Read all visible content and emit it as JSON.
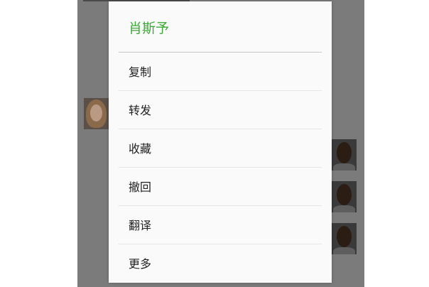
{
  "dialog": {
    "title": "肖斯予",
    "title_color": "#3aaa35",
    "items": [
      {
        "label": "复制"
      },
      {
        "label": "转发"
      },
      {
        "label": "收藏"
      },
      {
        "label": "撤回"
      },
      {
        "label": "翻译"
      },
      {
        "label": "更多"
      }
    ]
  },
  "background": {
    "overlay_color": "#7b7b7b"
  }
}
